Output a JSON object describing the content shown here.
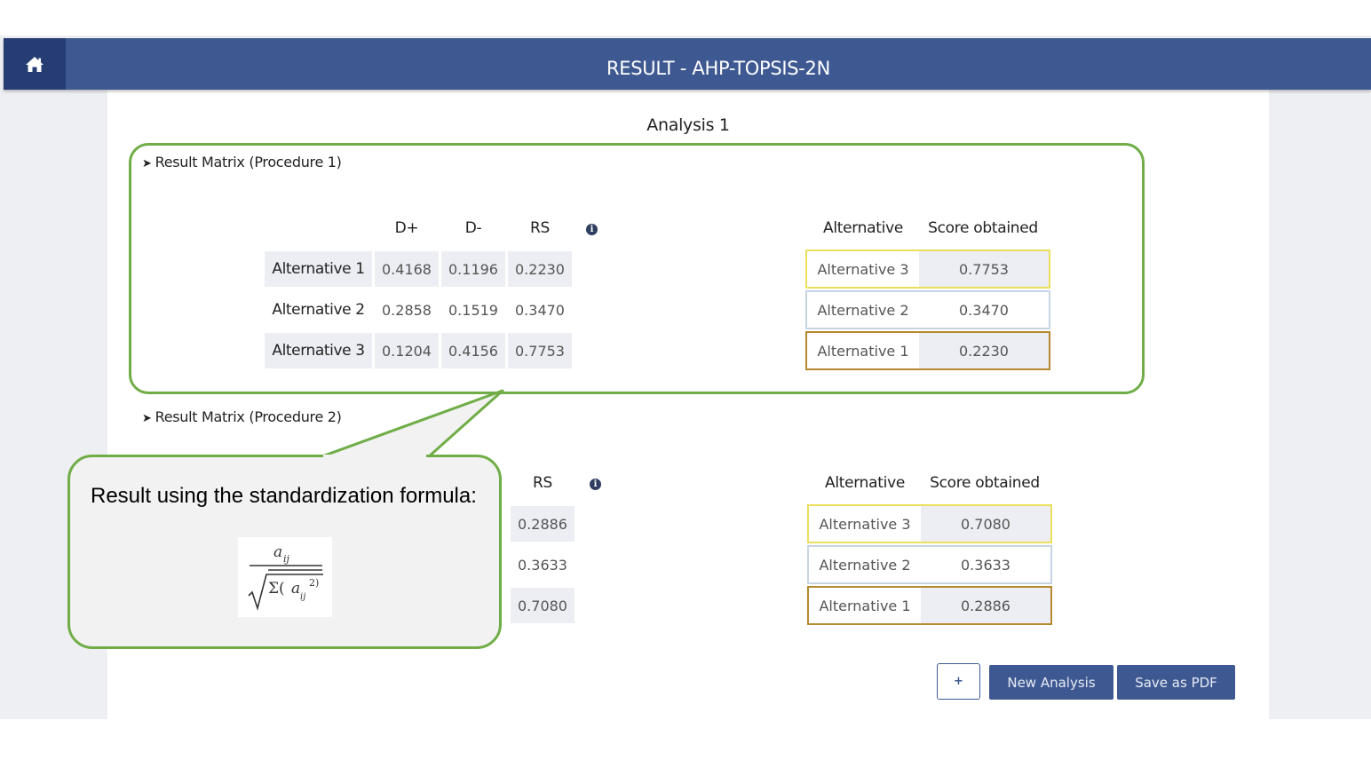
{
  "header": {
    "title": "RESULT - AHP-TOPSIS-2N",
    "home_icon": "home-icon"
  },
  "analysis": {
    "title": "Analysis 1"
  },
  "procedure1": {
    "heading": "Result Matrix (Procedure 1)",
    "columns": [
      "D+",
      "D-",
      "RS"
    ],
    "rows": [
      {
        "label": "Alternative 1",
        "d_plus": "0.4168",
        "d_minus": "0.1196",
        "rs": "0.2230"
      },
      {
        "label": "Alternative 2",
        "d_plus": "0.2858",
        "d_minus": "0.1519",
        "rs": "0.3470"
      },
      {
        "label": "Alternative 3",
        "d_plus": "0.1204",
        "d_minus": "0.4156",
        "rs": "0.7753"
      }
    ],
    "ranking_headers": {
      "alternative": "Alternative",
      "score": "Score obtained"
    },
    "ranking": [
      {
        "alternative": "Alternative 3",
        "score": "0.7753"
      },
      {
        "alternative": "Alternative 2",
        "score": "0.3470"
      },
      {
        "alternative": "Alternative 1",
        "score": "0.2230"
      }
    ]
  },
  "procedure2": {
    "heading": "Result Matrix (Procedure 2)",
    "columns": [
      "RS"
    ],
    "rs_values": [
      "0.2886",
      "0.3633",
      "0.7080"
    ],
    "ranking_headers": {
      "alternative": "Alternative",
      "score": "Score obtained"
    },
    "ranking": [
      {
        "alternative": "Alternative 3",
        "score": "0.7080"
      },
      {
        "alternative": "Alternative 2",
        "score": "0.3633"
      },
      {
        "alternative": "Alternative 1",
        "score": "0.2886"
      }
    ]
  },
  "callout": {
    "text": "Result using the standardization formula:",
    "formula_numerator": "a",
    "formula_sub": "ij",
    "formula_sigma": "Σ(",
    "formula_exp": "2)"
  },
  "actions": {
    "plus_label": "+",
    "new_analysis": "New Analysis",
    "save_pdf": "Save as PDF"
  },
  "colors": {
    "header": "#3e5992",
    "home_button": "#263d74",
    "rank1_border": "#ecdf5c",
    "rank2_border": "#c7d4e3",
    "rank3_border": "#b58a2e",
    "callout_border": "#70ad47"
  }
}
